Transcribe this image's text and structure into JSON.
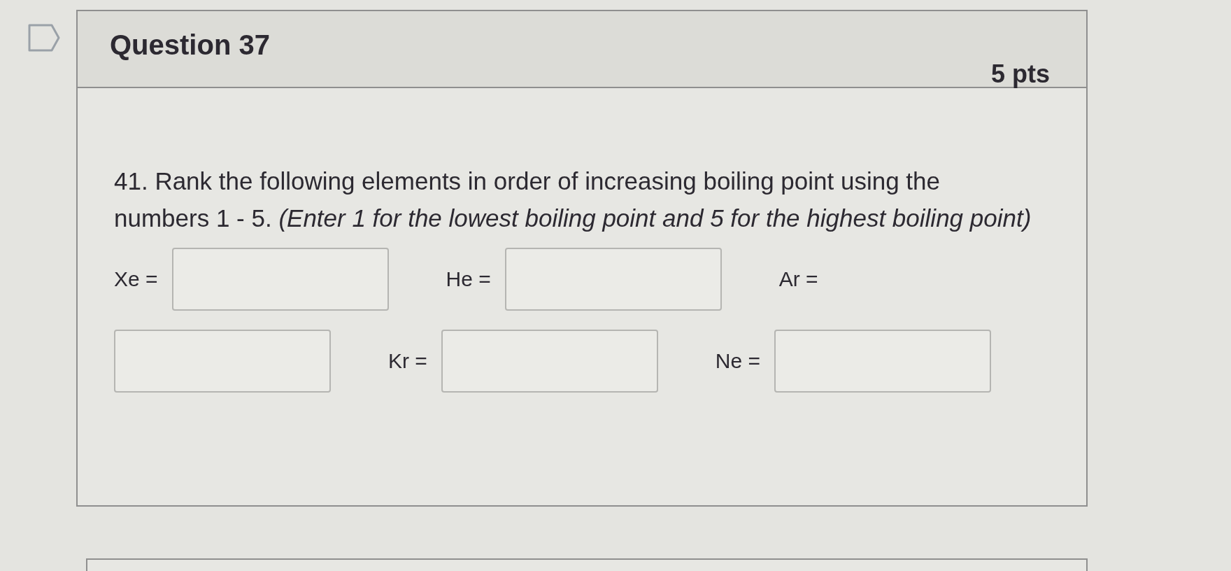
{
  "flag": {
    "flagged": false
  },
  "question": {
    "title": "Question 37",
    "points": "5 pts",
    "prompt_lines": [
      "41. Rank the following elements in order of increasing boiling point using the",
      "numbers 1 - 5. *(Enter 1 for the lowest boiling point and 5 for the highest boiling point)*"
    ],
    "answers": [
      {
        "label": "Xe ="
      },
      {
        "label": "He ="
      },
      {
        "label": "Ar ="
      },
      {
        "label": "Kr ="
      },
      {
        "label": "Ne ="
      }
    ]
  }
}
